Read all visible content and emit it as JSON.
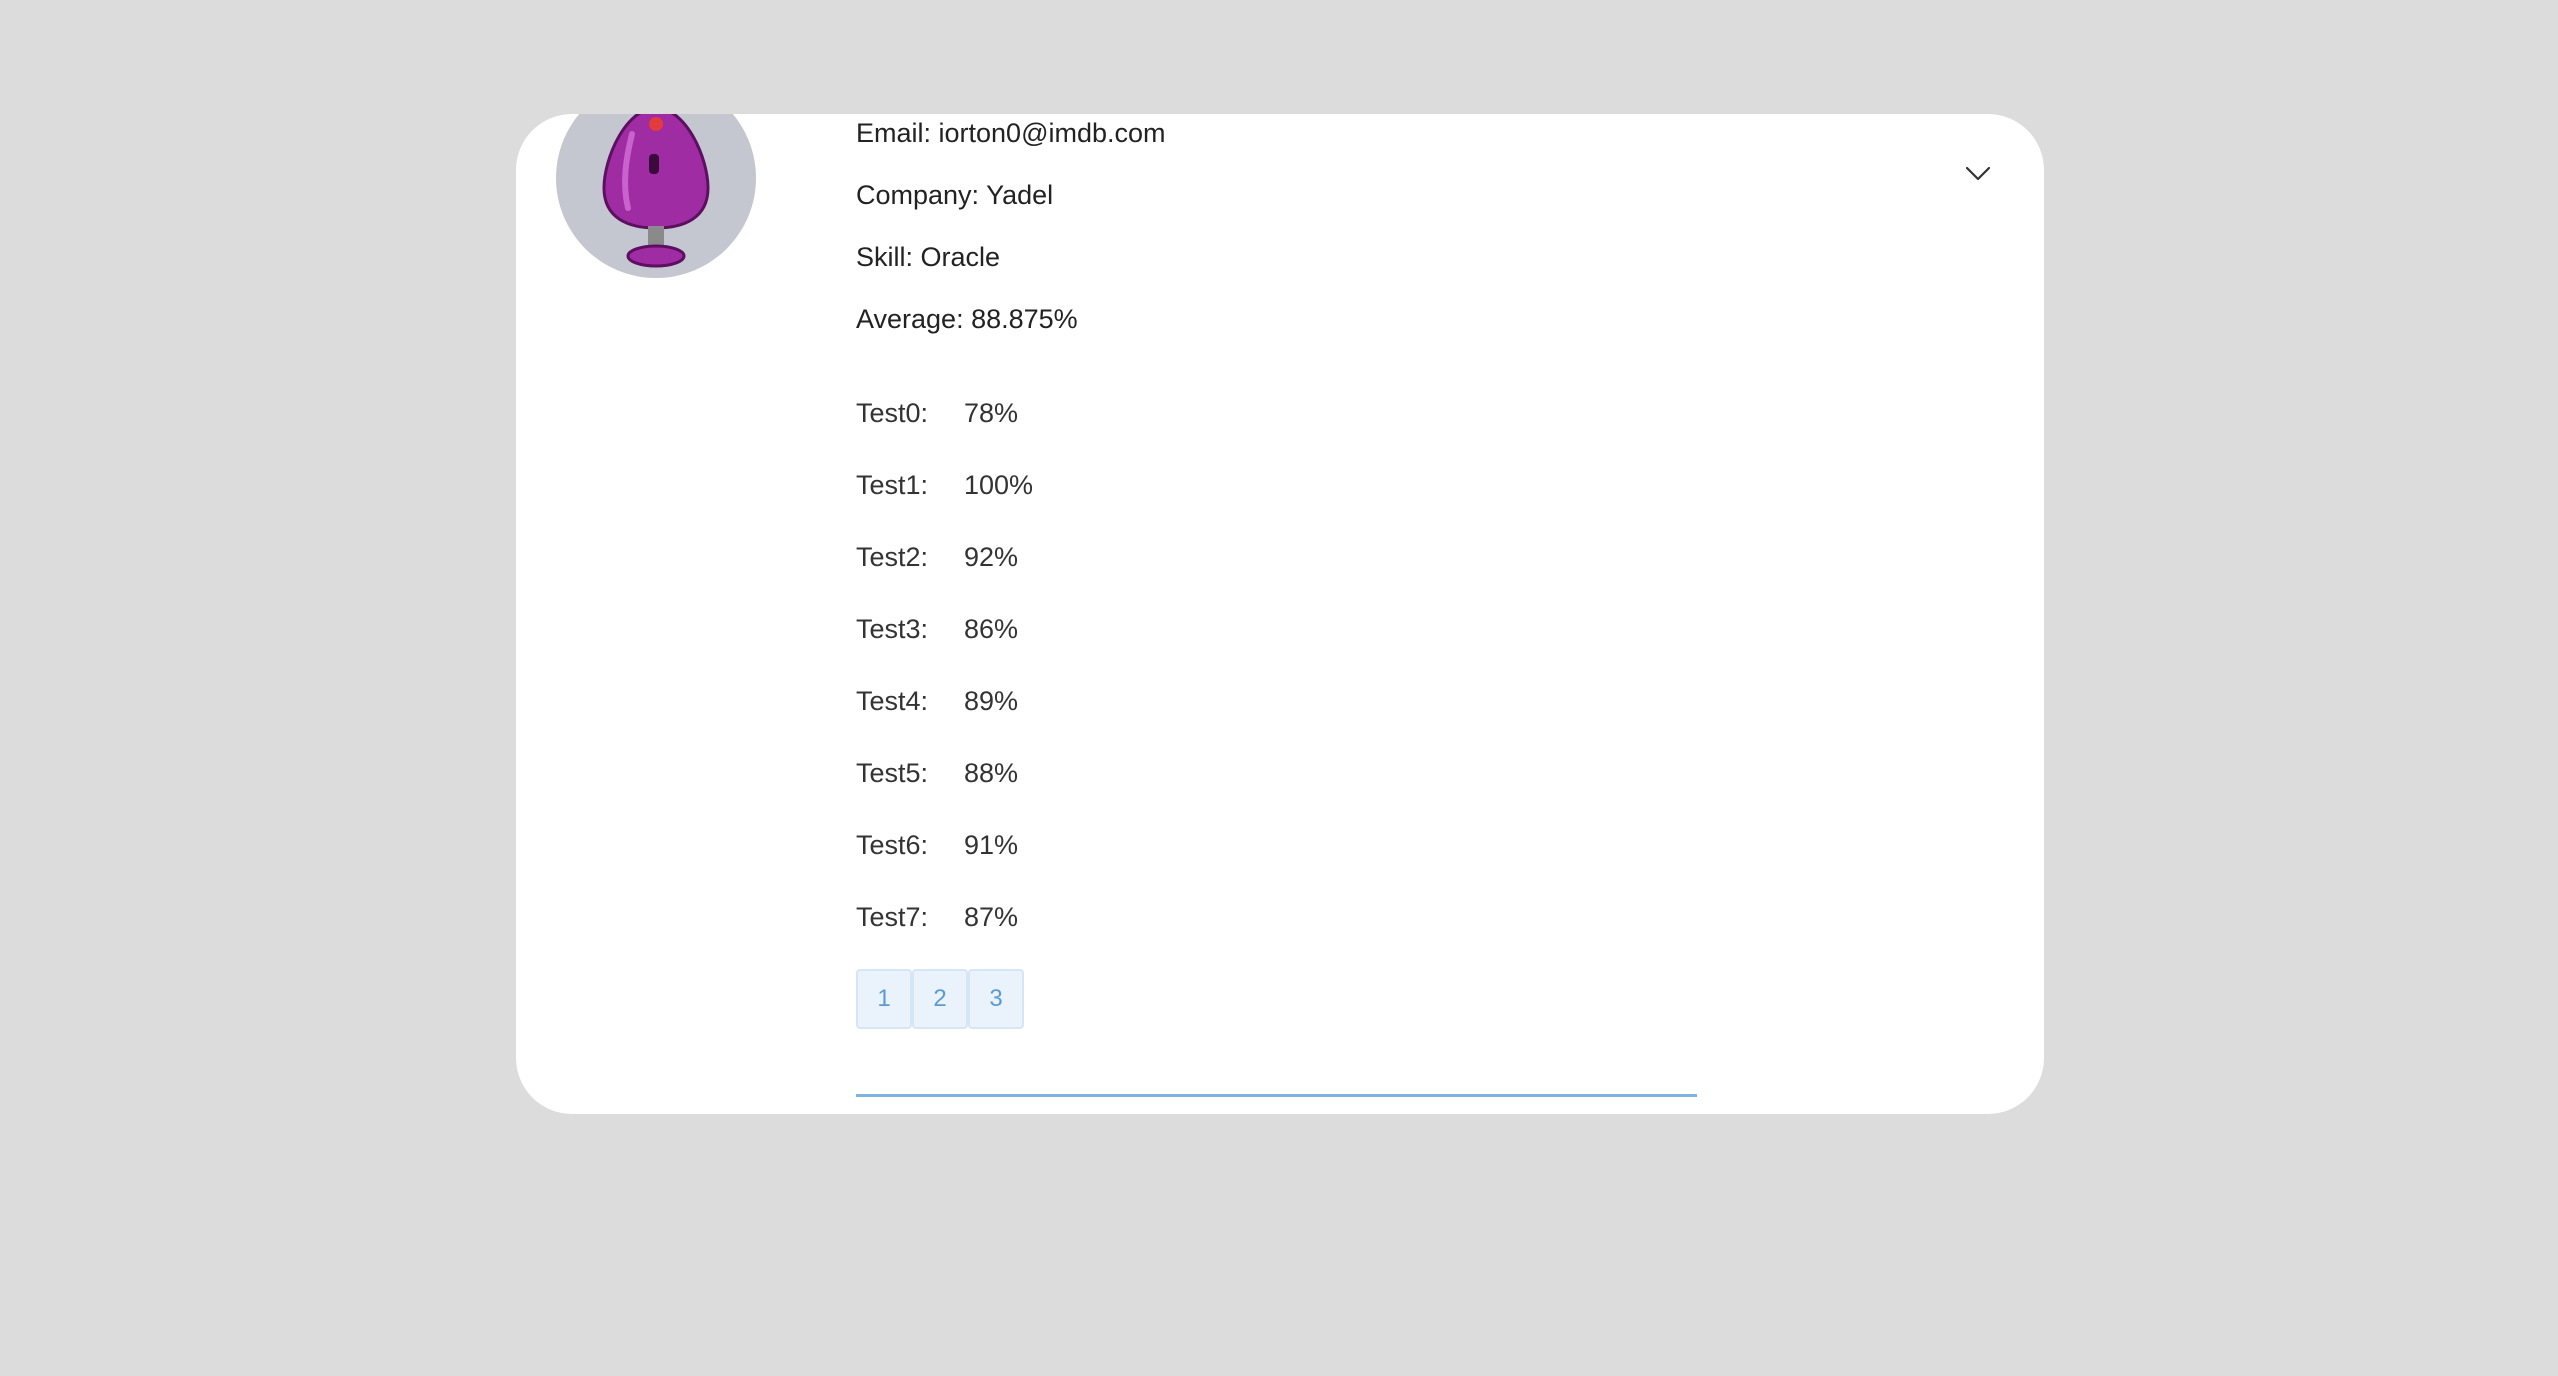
{
  "profile": {
    "email": "Email: iorton0@imdb.com",
    "company": "Company: Yadel",
    "skill": "Skill: Oracle",
    "average": "Average: 88.875%"
  },
  "tests": [
    {
      "label": "Test0:",
      "value": "78%"
    },
    {
      "label": "Test1:",
      "value": "100%"
    },
    {
      "label": "Test2:",
      "value": "92%"
    },
    {
      "label": "Test3:",
      "value": "86%"
    },
    {
      "label": "Test4:",
      "value": "89%"
    },
    {
      "label": "Test5:",
      "value": "88%"
    },
    {
      "label": "Test6:",
      "value": "91%"
    },
    {
      "label": "Test7:",
      "value": "87%"
    }
  ],
  "pagination": {
    "pages": [
      "1",
      "2",
      "3"
    ]
  },
  "icons": {
    "toggle": "chevron-down-icon",
    "avatar": "robot-avatar"
  },
  "colors": {
    "background": "#dcdcdc",
    "card": "#ffffff",
    "accent": "#5b9bd5",
    "avatar_bg": "#c4c7cf"
  }
}
